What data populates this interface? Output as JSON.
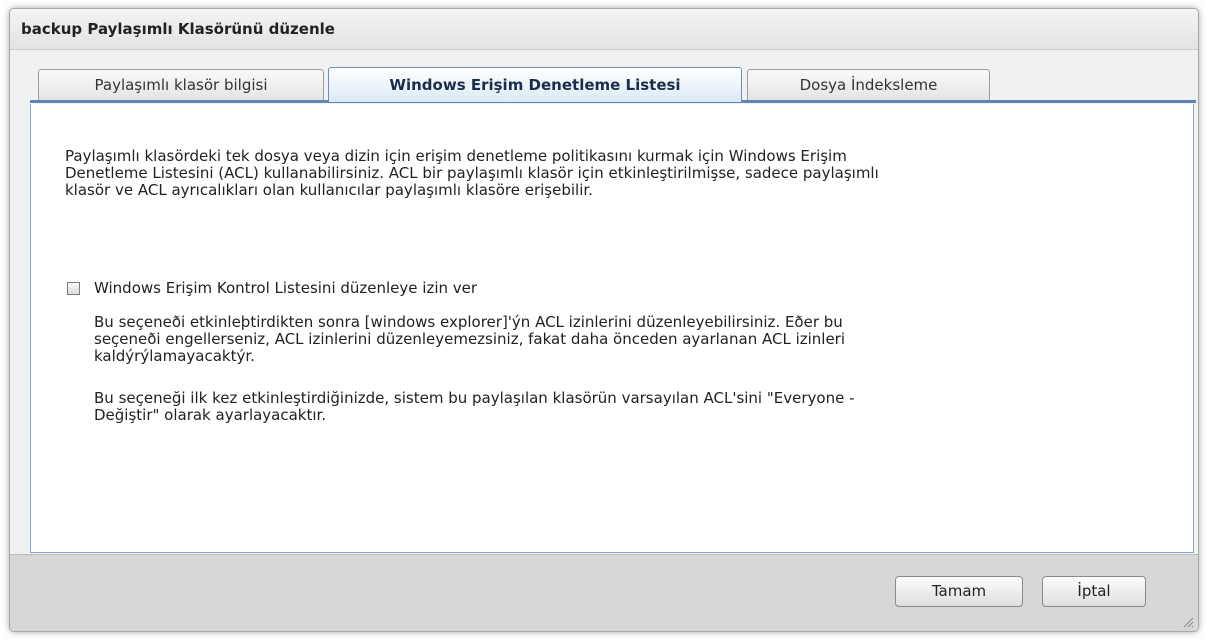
{
  "dialog": {
    "title": "backup Paylaşımlı Klasörünü düzenle"
  },
  "tabs": [
    {
      "label": "Paylaşımlı klasör bilgisi",
      "active": false
    },
    {
      "label": "Windows Erişim Denetleme Listesi",
      "active": true
    },
    {
      "label": "Dosya İndeksleme",
      "active": false
    }
  ],
  "content": {
    "description_lines": [
      "Paylaşımlı klasördeki tek dosya veya dizin için erişim denetleme politikasını kurmak için Windows Erişim",
      "Denetleme Listesini (ACL) kullanabilirsiniz. ACL bir paylaşımlı klasör için etkinleştirilmişse, sadece paylaşımlı",
      "klasör ve ACL ayrıcalıkları olan kullanıcılar paylaşımlı klasöre erişebilir."
    ],
    "checkbox": {
      "label": "Windows Erişim Kontrol Listesini düzenleye izin ver",
      "checked": false
    },
    "note1_lines": [
      "Bu seçeneði etkinleþtirdikten sonra [windows explorer]'ýn ACL izinlerini düzenleyebilirsiniz. Eðer bu",
      "seçeneði engellerseniz, ACL izinlerini düzenleyemezsiniz, fakat daha önceden ayarlanan ACL izinleri",
      "kaldýrýlamayacaktýr."
    ],
    "note2_lines": [
      "Bu seçeneği ilk kez etkinleştirdiğinizde, sistem bu paylaşılan klasörün varsayılan ACL'sini \"Everyone -",
      "Değiştir\" olarak ayarlayacaktır."
    ]
  },
  "footer": {
    "ok_label": "Tamam",
    "cancel_label": "İptal"
  },
  "icons": {
    "resize_grip": "resize-grip-icon"
  },
  "colors": {
    "accent": "#5b86b7",
    "active_tab_text": "#1a2e4a",
    "footer_bg": "#d7d7d7"
  }
}
